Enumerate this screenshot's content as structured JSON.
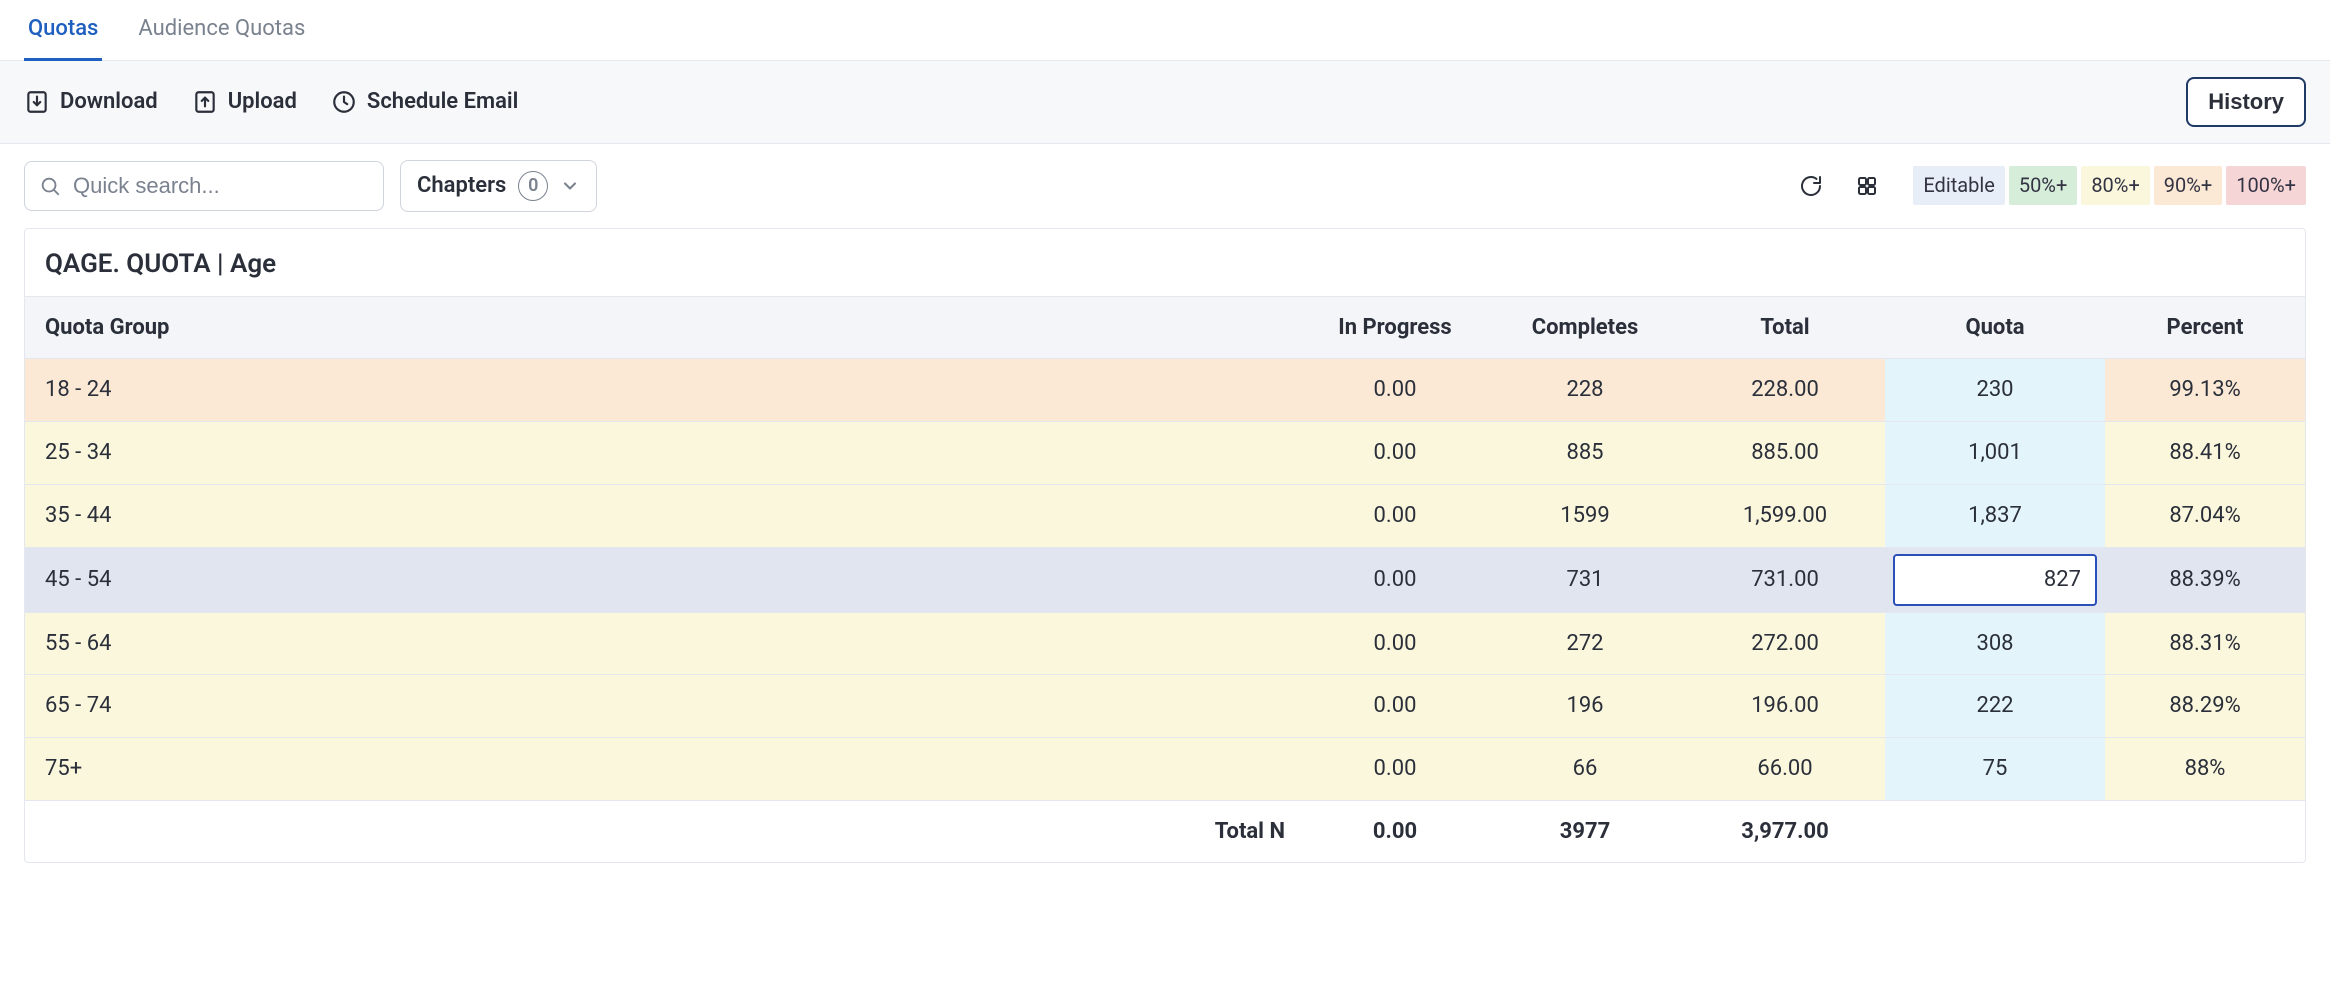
{
  "tabs": {
    "quotas": "Quotas",
    "audience_quotas": "Audience Quotas",
    "active": "quotas"
  },
  "toolbar": {
    "download": "Download",
    "upload": "Upload",
    "schedule_email": "Schedule Email",
    "history": "History"
  },
  "filterbar": {
    "search_placeholder": "Quick search...",
    "chapters_label": "Chapters",
    "chapters_count": "0"
  },
  "legend": {
    "editable": "Editable",
    "p50": "50%+",
    "p80": "80%+",
    "p90": "90%+",
    "p100": "100%+"
  },
  "panel": {
    "title": "QAGE. QUOTA | Age"
  },
  "table": {
    "headers": {
      "group": "Quota Group",
      "in_progress": "In Progress",
      "completes": "Completes",
      "total": "Total",
      "quota": "Quota",
      "percent": "Percent"
    },
    "rows": [
      {
        "group": "18 - 24",
        "in_progress": "0.00",
        "completes": "228",
        "total": "228.00",
        "quota": "230",
        "percent": "99.13%",
        "tier": "90"
      },
      {
        "group": "25 - 34",
        "in_progress": "0.00",
        "completes": "885",
        "total": "885.00",
        "quota": "1,001",
        "percent": "88.41%",
        "tier": "80"
      },
      {
        "group": "35 - 44",
        "in_progress": "0.00",
        "completes": "1599",
        "total": "1,599.00",
        "quota": "1,837",
        "percent": "87.04%",
        "tier": "80"
      },
      {
        "group": "45 - 54",
        "in_progress": "0.00",
        "completes": "731",
        "total": "731.00",
        "quota": "827",
        "percent": "88.39%",
        "tier": "80",
        "editing": true,
        "selected": true
      },
      {
        "group": "55 - 64",
        "in_progress": "0.00",
        "completes": "272",
        "total": "272.00",
        "quota": "308",
        "percent": "88.31%",
        "tier": "80"
      },
      {
        "group": "65 - 74",
        "in_progress": "0.00",
        "completes": "196",
        "total": "196.00",
        "quota": "222",
        "percent": "88.29%",
        "tier": "80"
      },
      {
        "group": "75+",
        "in_progress": "0.00",
        "completes": "66",
        "total": "66.00",
        "quota": "75",
        "percent": "88%",
        "tier": "80"
      }
    ],
    "footer": {
      "label": "Total N",
      "in_progress": "0.00",
      "completes": "3977",
      "total": "3,977.00"
    }
  }
}
